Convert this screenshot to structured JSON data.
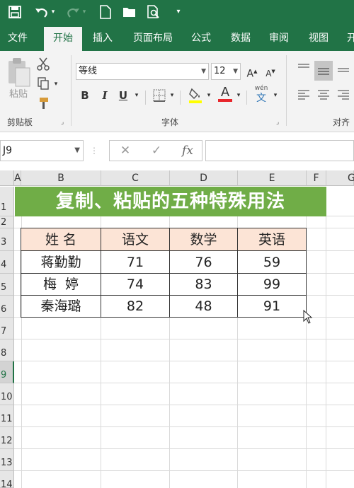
{
  "qat": {
    "icons": [
      "save-icon",
      "undo-icon",
      "redo-icon",
      "new-file-icon",
      "open-folder-icon",
      "print-preview-icon",
      "customize-icon"
    ]
  },
  "tabs": [
    "文件",
    "开始",
    "插入",
    "页面布局",
    "公式",
    "数据",
    "审阅",
    "视图",
    "开"
  ],
  "ribbon": {
    "paste_label": "粘贴",
    "clipboard_label": "剪贴板",
    "font_name": "等线",
    "font_size": "12",
    "font_label": "字体",
    "align_label": "对齐",
    "bold": "B",
    "italic": "I",
    "underline": "U",
    "grow": "A",
    "shrink": "A",
    "font_color": "A",
    "phonetic": "wén"
  },
  "formula_bar": {
    "name_box": "J9",
    "fx": "fx",
    "formula": ""
  },
  "columns": [
    "A",
    "B",
    "C",
    "D",
    "E",
    "F",
    "G"
  ],
  "rows": [
    "1",
    "2",
    "3",
    "4",
    "5",
    "6",
    "7",
    "8",
    "9",
    "10",
    "11",
    "12",
    "13",
    "14"
  ],
  "title": "复制、粘贴的五种特殊用法",
  "table": {
    "headers": [
      "姓 名",
      "语文",
      "数学",
      "英语"
    ],
    "rows": [
      [
        "蒋勤勤",
        "71",
        "76",
        "59"
      ],
      [
        "梅  婷",
        "74",
        "83",
        "99"
      ],
      [
        "秦海璐",
        "82",
        "48",
        "91"
      ]
    ]
  },
  "colors": {
    "excel_green": "#217346",
    "title_green": "#70ad47",
    "header_peach": "#fce4d6"
  }
}
